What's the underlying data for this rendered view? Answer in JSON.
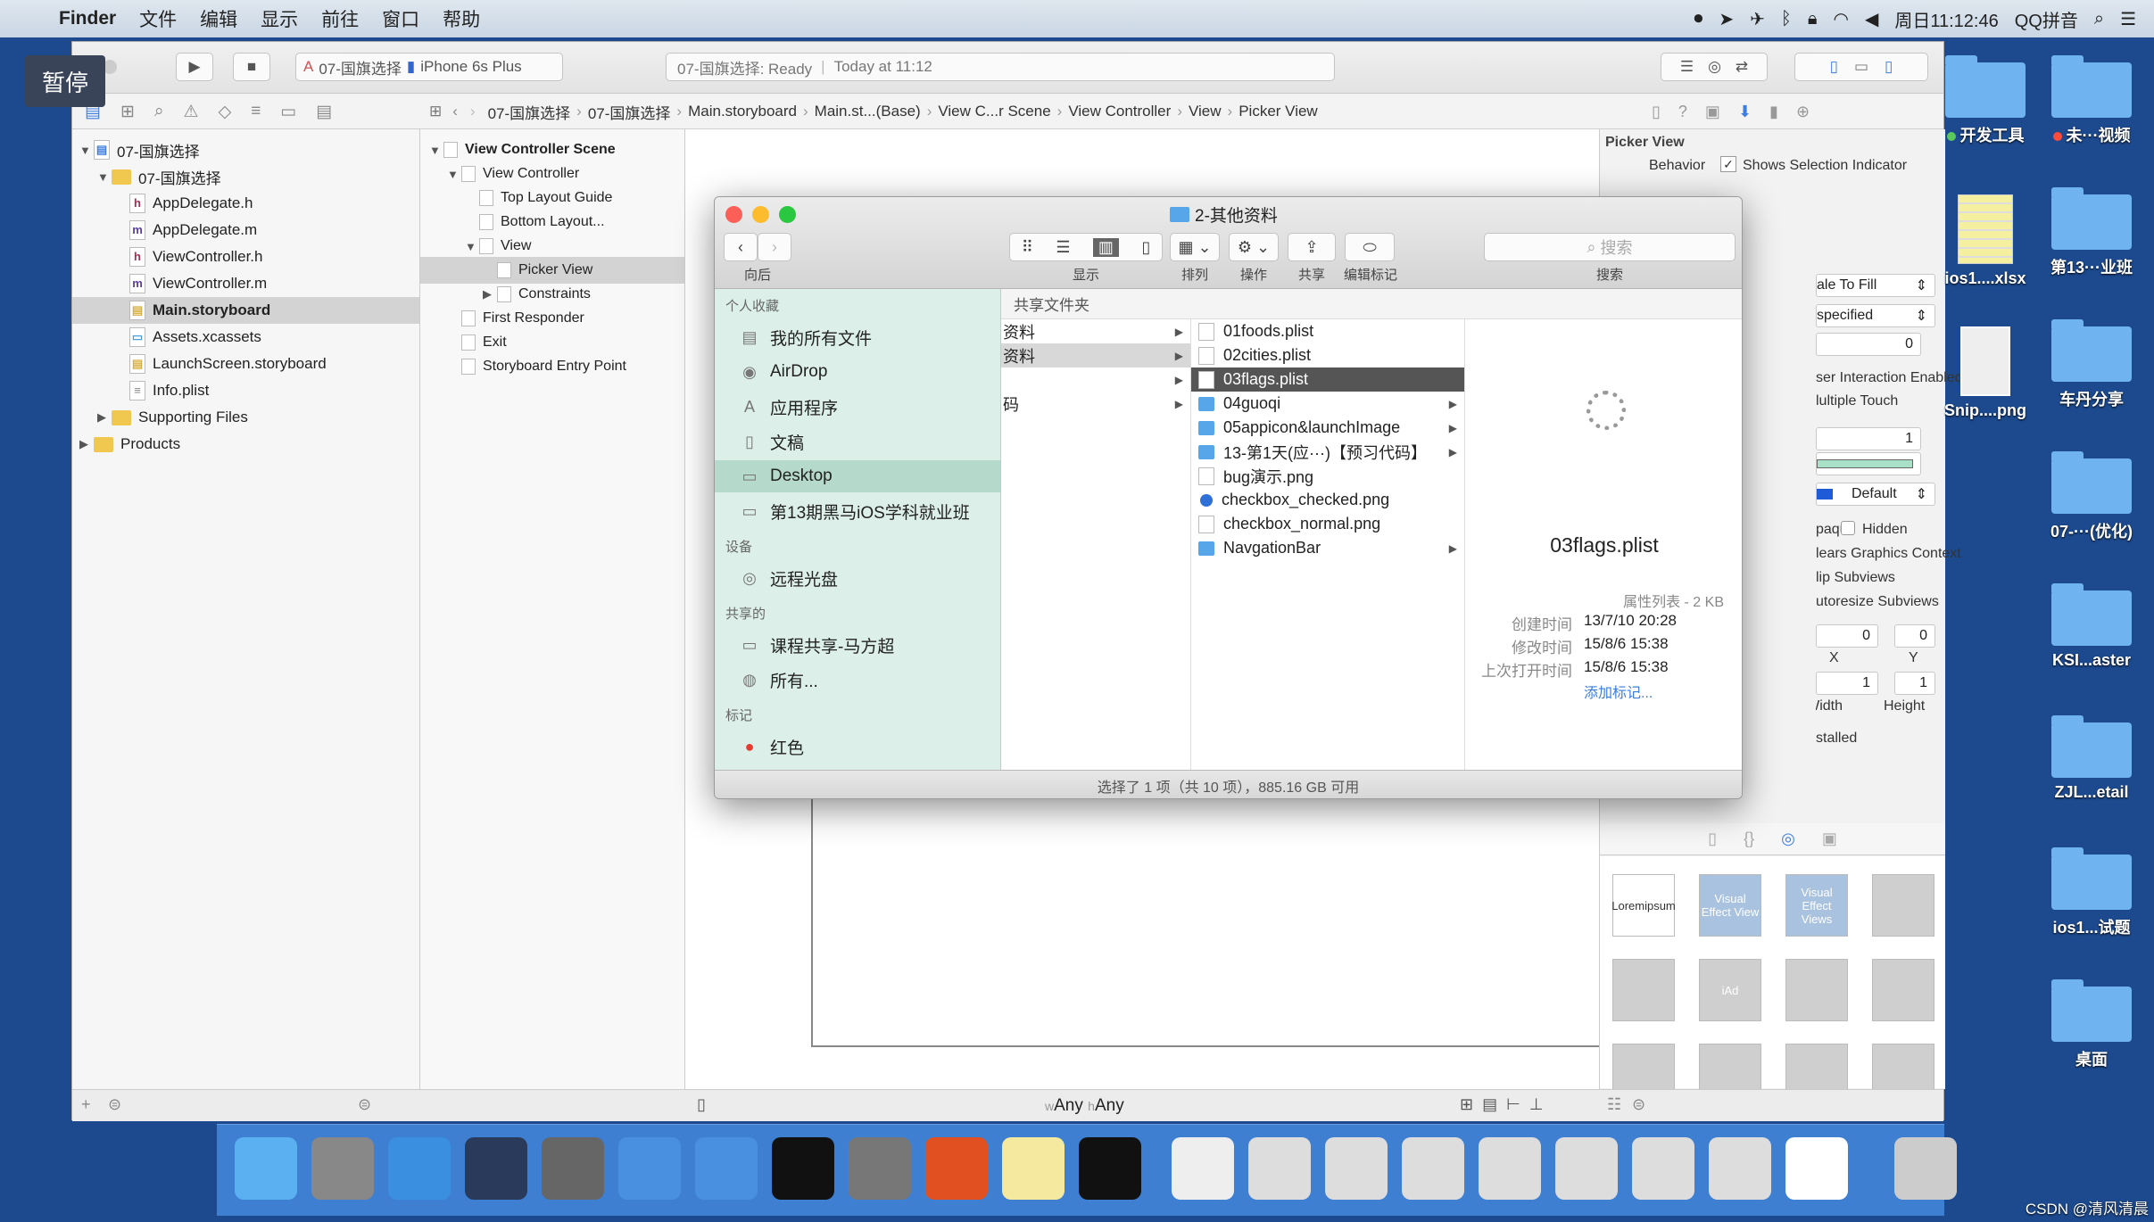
{
  "menubar": {
    "app": "Finder",
    "items": [
      "文件",
      "编辑",
      "显示",
      "前往",
      "窗口",
      "帮助"
    ],
    "clock": "周日11:12:46",
    "ime": "QQ拼音"
  },
  "overlay_badge": "暂停",
  "xcode": {
    "scheme": "07-国旗选择",
    "device": "iPhone 6s Plus",
    "status": "07-国旗选择: Ready",
    "status_time": "Today at 11:12",
    "jumpbar": [
      "07-国旗选择",
      "07-国旗选择",
      "Main.storyboard",
      "Main.st...(Base)",
      "View C...r Scene",
      "View Controller",
      "View",
      "Picker View"
    ],
    "navigator": [
      {
        "label": "07-国旗选择",
        "indent": 0,
        "icon": "project",
        "tri": "▼"
      },
      {
        "label": "07-国旗选择",
        "indent": 1,
        "icon": "folder",
        "tri": "▼"
      },
      {
        "label": "AppDelegate.h",
        "indent": 2,
        "icon": "h"
      },
      {
        "label": "AppDelegate.m",
        "indent": 2,
        "icon": "m"
      },
      {
        "label": "ViewController.h",
        "indent": 2,
        "icon": "h"
      },
      {
        "label": "ViewController.m",
        "indent": 2,
        "icon": "m"
      },
      {
        "label": "Main.storyboard",
        "indent": 2,
        "icon": "sb",
        "selected": true
      },
      {
        "label": "Assets.xcassets",
        "indent": 2,
        "icon": "assets"
      },
      {
        "label": "LaunchScreen.storyboard",
        "indent": 2,
        "icon": "sb"
      },
      {
        "label": "Info.plist",
        "indent": 2,
        "icon": "plist"
      },
      {
        "label": "Supporting Files",
        "indent": 1,
        "icon": "folder",
        "tri": "▶"
      },
      {
        "label": "Products",
        "indent": 0,
        "icon": "folder",
        "tri": "▶"
      }
    ],
    "outline": [
      {
        "label": "View Controller Scene",
        "indent": 0,
        "tri": "▼",
        "bold": true
      },
      {
        "label": "View Controller",
        "indent": 1,
        "tri": "▼"
      },
      {
        "label": "Top Layout Guide",
        "indent": 2
      },
      {
        "label": "Bottom Layout...",
        "indent": 2
      },
      {
        "label": "View",
        "indent": 2,
        "tri": "▼"
      },
      {
        "label": "Picker View",
        "indent": 3,
        "selected": true
      },
      {
        "label": "Constraints",
        "indent": 3,
        "tri": "▶"
      },
      {
        "label": "First Responder",
        "indent": 1
      },
      {
        "label": "Exit",
        "indent": 1
      },
      {
        "label": "Storyboard Entry Point",
        "indent": 1
      }
    ],
    "size_class": {
      "w": "Any",
      "h": "Any",
      "w_prefix": "w",
      "h_prefix": "h"
    },
    "inspector": {
      "section": "Picker View",
      "behavior_label": "Behavior",
      "shows_selection": "Shows Selection Indicator",
      "shows_selection_checked": true,
      "mode": "ale To Fill",
      "semantic": "specified",
      "tag": "0",
      "user_interaction": "ser Interaction Enabled",
      "multiple_touch": "lultiple Touch",
      "alpha": "1",
      "tint": "Default",
      "opaque": "paque",
      "hidden": "Hidden",
      "hidden_checked": false,
      "clears": "lears Graphics Context",
      "clip": "lip Subviews",
      "autoresize": "utoresize Subviews",
      "x": "0",
      "y": "0",
      "width": "1",
      "height": "1",
      "x_label": "X",
      "y_label": "Y",
      "width_label": "Width",
      "height_label": "Height",
      "installed": "stalled",
      "library": [
        "Loremipsum",
        "Visual Effect View",
        "Visual Effect Views",
        "",
        "",
        "iAd",
        "",
        "",
        "",
        "",
        "",
        ""
      ]
    }
  },
  "finder": {
    "title": "2-其他资料",
    "toolbar": {
      "back": "向后",
      "view": "显示",
      "arrange": "排列",
      "action": "操作",
      "share": "共享",
      "tags": "编辑标记",
      "search": "搜索",
      "search_placeholder": "搜索"
    },
    "sidebar": [
      {
        "type": "head",
        "label": "个人收藏"
      },
      {
        "label": "我的所有文件",
        "icon": "all-files"
      },
      {
        "label": "AirDrop",
        "icon": "airdrop"
      },
      {
        "label": "应用程序",
        "icon": "applications"
      },
      {
        "label": "文稿",
        "icon": "documents"
      },
      {
        "label": "Desktop",
        "icon": "desktop",
        "selected": true
      },
      {
        "label": "第13期黑马iOS学科就业班",
        "icon": "folder"
      },
      {
        "type": "head",
        "label": "设备"
      },
      {
        "label": "远程光盘",
        "icon": "disc"
      },
      {
        "type": "head",
        "label": "共享的"
      },
      {
        "label": "课程共享-马方超",
        "icon": "computer"
      },
      {
        "label": "所有...",
        "icon": "network"
      },
      {
        "type": "head",
        "label": "标记"
      },
      {
        "label": "红色",
        "icon": "red-tag"
      }
    ],
    "path_header": "共享文件夹",
    "column1": [
      {
        "label": "资料"
      },
      {
        "label": "资料",
        "selected": true
      },
      {
        "label": ""
      },
      {
        "label": "码"
      }
    ],
    "column2": [
      {
        "label": "01foods.plist",
        "kind": "file"
      },
      {
        "label": "02cities.plist",
        "kind": "file"
      },
      {
        "label": "03flags.plist",
        "kind": "file",
        "selected": true
      },
      {
        "label": "04guoqi",
        "kind": "folder"
      },
      {
        "label": "05appicon&launchImage",
        "kind": "folder"
      },
      {
        "label": "13-第1天(应···)【预习代码】",
        "kind": "folder"
      },
      {
        "label": "bug演示.png",
        "kind": "file"
      },
      {
        "label": "checkbox_checked.png",
        "kind": "checked"
      },
      {
        "label": "checkbox_normal.png",
        "kind": "file"
      },
      {
        "label": "NavgationBar",
        "kind": "folder"
      }
    ],
    "preview": {
      "name": "03flags.plist",
      "kind": "属性列表 - 2 KB",
      "meta": [
        {
          "k": "创建时间",
          "v": "13/7/10 20:28"
        },
        {
          "k": "修改时间",
          "v": "15/8/6 15:38"
        },
        {
          "k": "上次打开时间",
          "v": "15/8/6 15:38"
        }
      ],
      "add_tags": "添加标记..."
    },
    "status": "选择了 1 项（共 10 项），885.16 GB 可用"
  },
  "desktop": [
    {
      "label": "开发工具",
      "dot": "#5ac85a",
      "col": 0,
      "row": 0
    },
    {
      "label": "未···视频",
      "dot": "#ff4b3a",
      "col": 1,
      "row": 0
    },
    {
      "label": "ios1....xlsx",
      "col": 0,
      "row": 1,
      "kind": "xlsx"
    },
    {
      "label": "第13···业班",
      "col": 1,
      "row": 1
    },
    {
      "label": "Snip....png",
      "col": 0,
      "row": 2,
      "kind": "png"
    },
    {
      "label": "车丹分享",
      "col": 1,
      "row": 2
    },
    {
      "label": "07-···(优化)",
      "col": 1,
      "row": 3
    },
    {
      "label": "KSI...aster",
      "col": 1,
      "row": 4
    },
    {
      "label": "ZJL...etail",
      "col": 1,
      "row": 5
    },
    {
      "label": "ios1...试题",
      "col": 1,
      "row": 6
    },
    {
      "label": "桌面",
      "col": 1,
      "row": 7
    }
  ],
  "dock": [
    "finder",
    "launchpad",
    "safari",
    "mouse",
    "photo-booth",
    "xcode",
    "instruments",
    "terminal",
    "system-preferences",
    "wps",
    "notes",
    "console",
    "preview",
    "screenshot",
    "screenshot",
    "screenshot",
    "screenshot",
    "screenshot",
    "screenshot",
    "screenshot",
    "document",
    "trash"
  ],
  "watermark": "CSDN @清风清晨",
  "colors": {
    "desktop": "#1d4a8e",
    "dock": "#3e7fd1",
    "finder_sidebar": "#dcefe8",
    "selection": "#555555",
    "link": "#3b7ddd"
  }
}
